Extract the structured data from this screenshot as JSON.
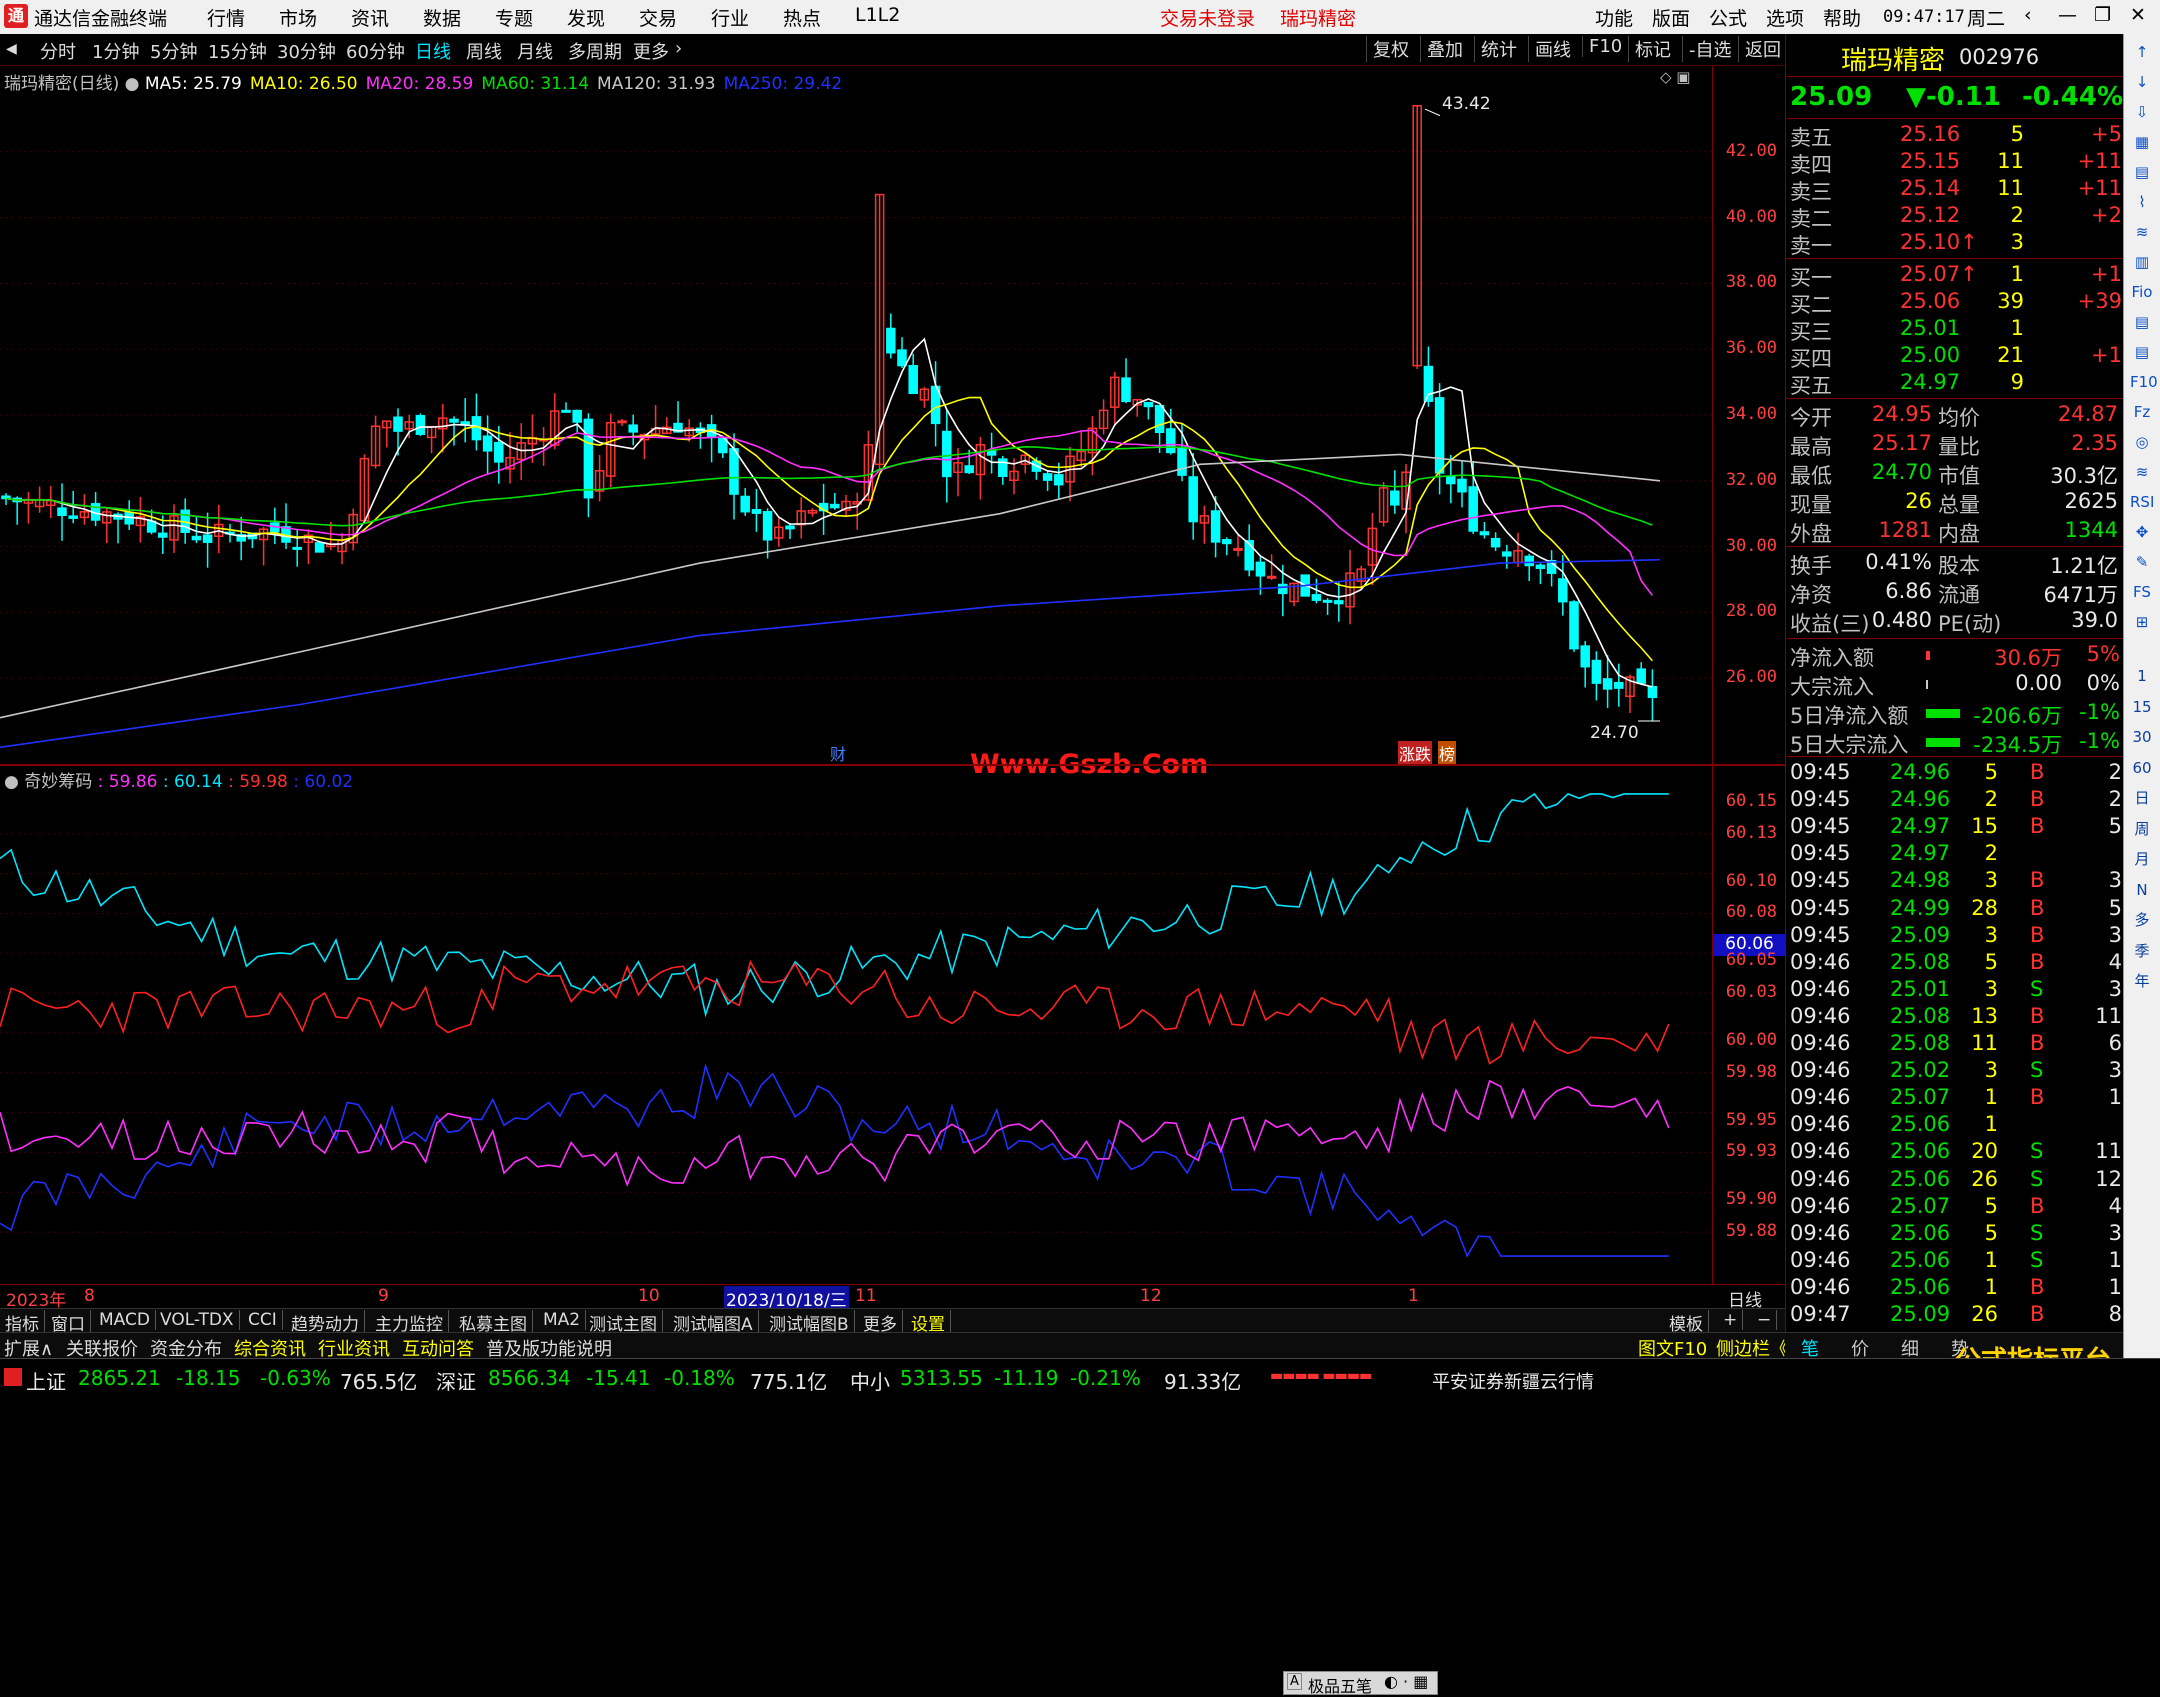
{
  "titlebar": {
    "app": "通达信金融终端",
    "menus": [
      "行情",
      "市场",
      "资讯",
      "数据",
      "专题",
      "发现",
      "交易",
      "行业",
      "热点",
      "L1L2"
    ],
    "trade_status": "交易未登录",
    "stock_name": "瑞玛精密",
    "right_menus": [
      "功能",
      "版面",
      "公式",
      "选项",
      "帮助"
    ],
    "time": "09:47:17",
    "weekday": "周二"
  },
  "periods": {
    "items": [
      "分时",
      "1分钟",
      "5分钟",
      "15分钟",
      "30分钟",
      "60分钟",
      "日线",
      "周线",
      "月线",
      "多周期",
      "更多"
    ],
    "selected": "日线",
    "buttons": [
      "复权",
      "叠加",
      "统计",
      "画线",
      "F10",
      "标记",
      "-自选",
      "返回"
    ]
  },
  "kchart": {
    "title": "瑞玛精密(日线)",
    "ma": [
      {
        "label": "MA5: 25.79",
        "color": "#ffffff"
      },
      {
        "label": "MA10: 26.50",
        "color": "#ffff00"
      },
      {
        "label": "MA20: 28.59",
        "color": "#ff30ff"
      },
      {
        "label": "MA60: 31.14",
        "color": "#00e000"
      },
      {
        "label": "MA120: 31.93",
        "color": "#c8c8c8"
      },
      {
        "label": "MA250: 29.42",
        "color": "#2030ff"
      }
    ],
    "axis": [
      "42.00",
      "40.00",
      "38.00",
      "36.00",
      "34.00",
      "32.00",
      "30.00",
      "28.00",
      "26.00"
    ],
    "high_label": "43.42",
    "low_label": "24.70",
    "events": [
      "财",
      "涨跌",
      "榜"
    ]
  },
  "indicator": {
    "title": "奇妙筹码",
    "values": [
      {
        "v": "59.86",
        "c": "#ff30ff"
      },
      {
        "v": "60.14",
        "c": "#00e5ff"
      },
      {
        "v": "59.98",
        "c": "#ff3030"
      },
      {
        "v": "60.02",
        "c": "#2030ff"
      }
    ],
    "axis": [
      "60.15",
      "60.13",
      "60.10",
      "60.08",
      "60.05",
      "60.03",
      "60.00",
      "59.98",
      "59.95",
      "59.93",
      "59.90",
      "59.88"
    ],
    "current": "60.06",
    "popup": "极品五笔"
  },
  "dates": {
    "items": [
      "2023年",
      "8",
      "9",
      "10",
      "2023/10/18/三",
      "11",
      "12",
      "1"
    ],
    "right": "日线"
  },
  "tabs": [
    "指标",
    "窗口",
    "MACD",
    "VOL-TDX",
    "CCI",
    "趋势动力",
    "主力监控",
    "私募主图",
    "MA2",
    "测试主图",
    "测试幅图A",
    "测试幅图B",
    "更多",
    "设置"
  ],
  "tabs_right": [
    "模板",
    "+",
    "−"
  ],
  "ext": {
    "items": [
      "扩展∧",
      "关联报价",
      "资金分布",
      "综合资讯",
      "行业资讯",
      "互动问答",
      "普及版功能说明"
    ],
    "right": [
      "图文F10",
      "侧边栏《"
    ]
  },
  "quote": {
    "name": "瑞玛精密",
    "code": "002976",
    "price": "25.09",
    "change": "▼-0.11",
    "pct": "-0.44%",
    "asks": [
      [
        "卖五",
        "25.16",
        "5",
        "+5"
      ],
      [
        "卖四",
        "25.15",
        "11",
        "+11"
      ],
      [
        "卖三",
        "25.14",
        "11",
        "+11"
      ],
      [
        "卖二",
        "25.12",
        "2",
        "+2"
      ],
      [
        "卖一",
        "25.10↑",
        "3",
        ""
      ]
    ],
    "bids": [
      [
        "买一",
        "25.07↑",
        "1",
        "+1"
      ],
      [
        "买二",
        "25.06",
        "39",
        "+39"
      ],
      [
        "买三",
        "25.01",
        "1",
        ""
      ],
      [
        "买四",
        "25.00",
        "21",
        "+1"
      ],
      [
        "买五",
        "24.97",
        "9",
        ""
      ]
    ],
    "stats": [
      [
        "今开",
        "24.95",
        "均价",
        "24.87"
      ],
      [
        "最高",
        "25.17",
        "量比",
        "2.35"
      ],
      [
        "最低",
        "24.70",
        "市值",
        "30.3亿"
      ],
      [
        "现量",
        "26",
        "总量",
        "2625"
      ],
      [
        "外盘",
        "1281",
        "内盘",
        "1344"
      ]
    ],
    "stats2": [
      [
        "换手",
        "0.41%",
        "股本",
        "1.21亿"
      ],
      [
        "净资",
        "6.86",
        "流通",
        "6471万"
      ],
      [
        "收益(三)",
        "0.480",
        "PE(动)",
        "39.0"
      ]
    ],
    "flows": [
      [
        "净流入额",
        "30.6万",
        "5%"
      ],
      [
        "大宗流入",
        "0.00",
        "0%"
      ],
      [
        "5日净流入额",
        "-206.6万",
        "-1%"
      ],
      [
        "5日大宗流入",
        "-234.5万",
        "-1%"
      ]
    ],
    "ticks": [
      [
        "09:45",
        "24.96",
        "5",
        "B",
        "2"
      ],
      [
        "09:45",
        "24.96",
        "2",
        "B",
        "2"
      ],
      [
        "09:45",
        "24.97",
        "15",
        "B",
        "5"
      ],
      [
        "09:45",
        "24.97",
        "2",
        "",
        ""
      ],
      [
        "09:45",
        "24.98",
        "3",
        "B",
        "3"
      ],
      [
        "09:45",
        "24.99",
        "28",
        "B",
        "5"
      ],
      [
        "09:45",
        "25.09",
        "3",
        "B",
        "3"
      ],
      [
        "09:46",
        "25.08",
        "5",
        "B",
        "4"
      ],
      [
        "09:46",
        "25.01",
        "3",
        "S",
        "3"
      ],
      [
        "09:46",
        "25.08",
        "13",
        "B",
        "11"
      ],
      [
        "09:46",
        "25.08",
        "11",
        "B",
        "6"
      ],
      [
        "09:46",
        "25.02",
        "3",
        "S",
        "3"
      ],
      [
        "09:46",
        "25.07",
        "1",
        "B",
        "1"
      ],
      [
        "09:46",
        "25.06",
        "1",
        "",
        ""
      ],
      [
        "09:46",
        "25.06",
        "20",
        "S",
        "11"
      ],
      [
        "09:46",
        "25.06",
        "26",
        "S",
        "12"
      ],
      [
        "09:46",
        "25.07",
        "5",
        "B",
        "4"
      ],
      [
        "09:46",
        "25.06",
        "5",
        "S",
        "3"
      ],
      [
        "09:46",
        "25.06",
        "1",
        "S",
        "1"
      ],
      [
        "09:46",
        "25.06",
        "1",
        "B",
        "1"
      ],
      [
        "09:47",
        "25.09",
        "26",
        "B",
        "8"
      ]
    ],
    "bottom_tabs": [
      "笔",
      "价",
      "细",
      "势"
    ]
  },
  "status": {
    "sh_name": "上证",
    "sh": "2865.21",
    "sh_chg": "-18.15",
    "sh_pct": "-0.63%",
    "sh_amt": "765.5亿",
    "sz_name": "深证",
    "sz": "8566.34",
    "sz_chg": "-15.41",
    "sz_pct": "-0.18%",
    "sz_amt": "775.1亿",
    "zx_name": "中小",
    "zx": "5313.55",
    "zx_chg": "-11.19",
    "zx_pct": "-0.21%",
    "zx_amt": "91.33亿",
    "server": "平安证券新疆云行情"
  },
  "tools": [
    "↑",
    "↓",
    "⇩",
    "▦",
    "▤",
    "⌇",
    "≋",
    "▥",
    "Fio",
    "▤",
    "▤",
    "F10",
    "Fz",
    "◎",
    "≋",
    "RSI",
    "✥",
    "✎",
    "FS",
    "⊞",
    "1",
    "15",
    "30",
    "60",
    "日",
    "周",
    "月",
    "N",
    "多",
    "季",
    "年"
  ],
  "watermark": "Www.Gszb.Com",
  "watermark2": "公式指标平台"
}
